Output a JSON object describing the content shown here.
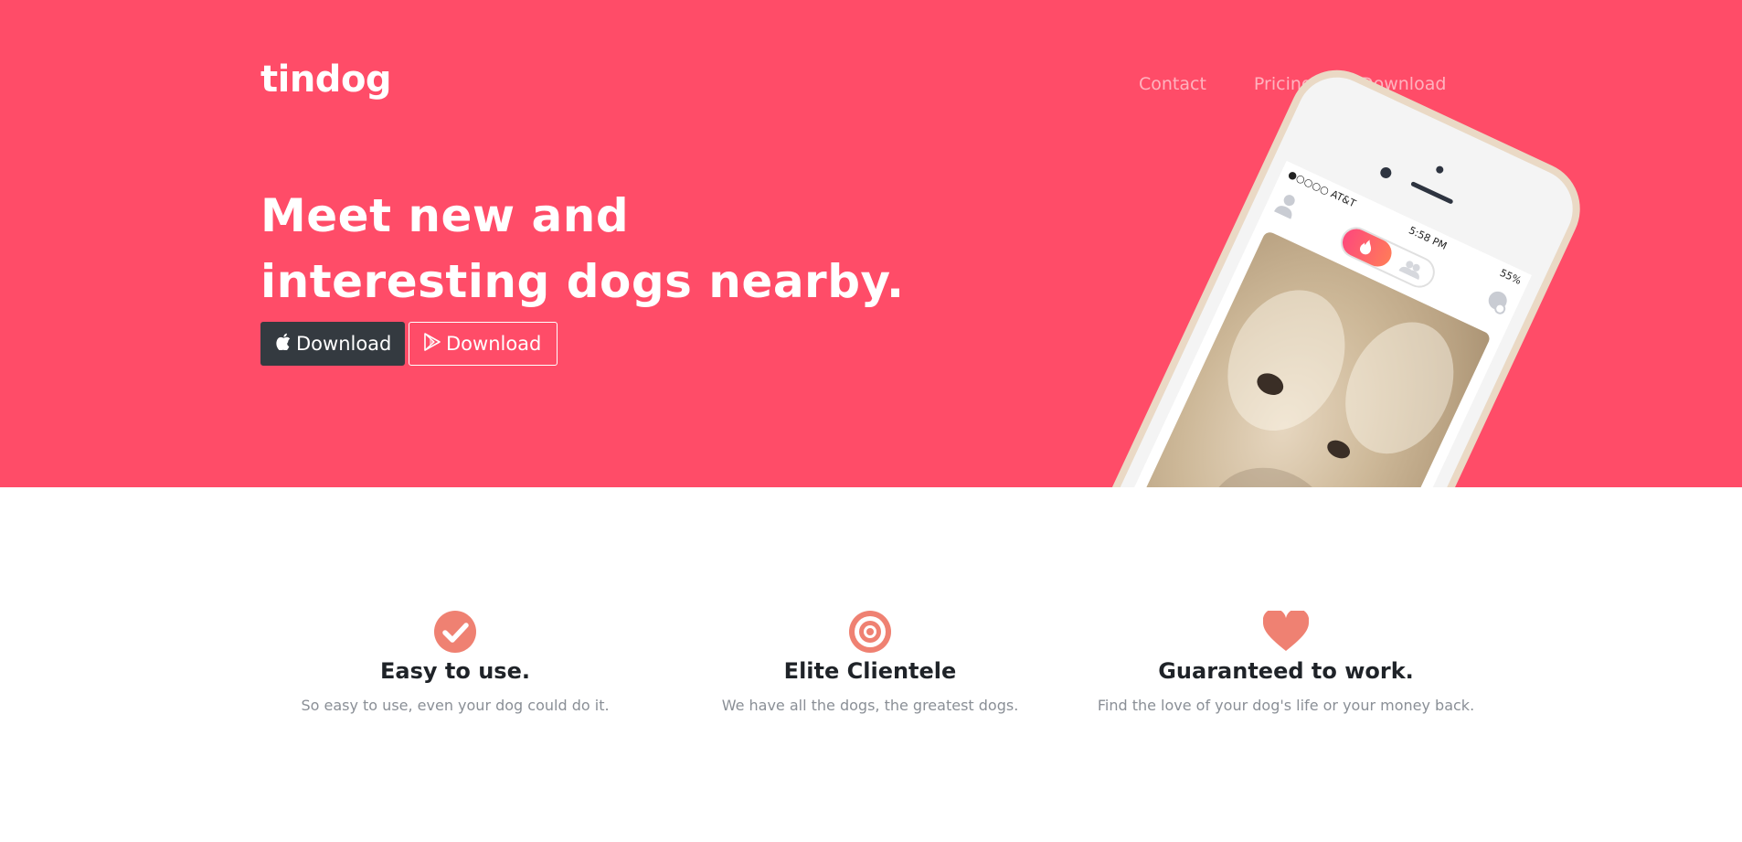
{
  "brand": {
    "name": "tindog"
  },
  "nav": {
    "items": [
      "Contact",
      "Pricing",
      "Download"
    ]
  },
  "hero": {
    "headline_line1": "Meet new and",
    "headline_line2": "interesting dogs nearby.",
    "apple_button": {
      "label": "Download",
      "icon": "apple-icon"
    },
    "play_button": {
      "label": "Download",
      "icon": "google-play-icon"
    },
    "phone": {
      "carrier": "●○○○○ AT&T",
      "time": "5:58 PM",
      "battery": "55%"
    }
  },
  "features": [
    {
      "icon": "check-circle-icon",
      "title": "Easy to use.",
      "text": "So easy to use, even your dog could do it."
    },
    {
      "icon": "bullseye-icon",
      "title": "Elite Clientele",
      "text": "We have all the dogs, the greatest dogs."
    },
    {
      "icon": "heart-icon",
      "title": "Guaranteed to work.",
      "text": "Find the love of your dog's life or your money back."
    }
  ],
  "colors": {
    "hero_bg": "#ff4c68",
    "icon_accent": "#ef8172",
    "dark_button": "#343a40"
  }
}
